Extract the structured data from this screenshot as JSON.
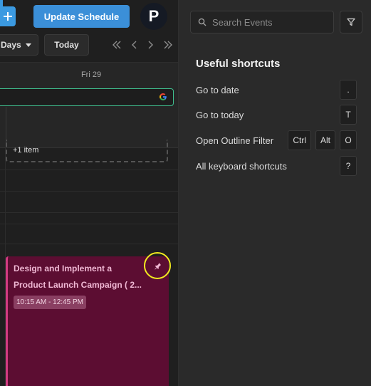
{
  "toolbar": {
    "add_icon": "plus-icon",
    "update_label": "Update Schedule",
    "avatar_initial": "P",
    "view_selected": "Days",
    "today_label": "Today",
    "nav_icons": [
      "double-chevron-left-icon",
      "chevron-left-icon",
      "chevron-right-icon",
      "double-chevron-right-icon"
    ]
  },
  "calendar": {
    "day_label": "Fri 29",
    "more_items": "+1 item",
    "google_icon": "google-icon",
    "event": {
      "title_line1": "Design and Implement a",
      "title_line2": "Product Launch Campaign ( 2...",
      "time": "10:15 AM - 12:45 PM",
      "pin_icon": "pin-icon",
      "accent": "#d33b82",
      "bg": "#5c0d32"
    }
  },
  "sidebar": {
    "search_placeholder": "Search Events",
    "search_icon": "search-icon",
    "filter_icon": "filter-icon",
    "shortcuts_title": "Useful shortcuts",
    "shortcuts": [
      {
        "label": "Go to date",
        "keys": [
          "."
        ]
      },
      {
        "label": "Go to today",
        "keys": [
          "T"
        ]
      },
      {
        "label": "Open Outline Filter",
        "keys": [
          "Ctrl",
          "Alt",
          "O"
        ]
      },
      {
        "label": "All keyboard shortcuts",
        "keys": [
          "?"
        ]
      }
    ]
  },
  "colors": {
    "primary": "#3b8fd8",
    "background": "#1f1f1f",
    "panel": "#2a2a2a",
    "highlight": "#f2ea1f",
    "google_event_border": "#3fbf8f"
  }
}
